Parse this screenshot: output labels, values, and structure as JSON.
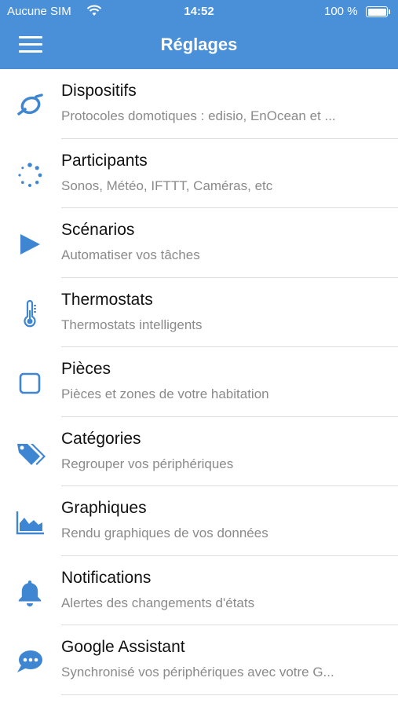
{
  "status_bar": {
    "carrier": "Aucune SIM",
    "time": "14:52",
    "battery_percent": "100 %"
  },
  "header": {
    "title": "Réglages"
  },
  "colors": {
    "accent": "#4a90d9",
    "icon": "#3f86d2"
  },
  "items": [
    {
      "label": "Dispositifs",
      "sub": "Protocoles domotiques : edisio, EnOcean et ...",
      "icon": "loop-icon"
    },
    {
      "label": "Participants",
      "sub": "Sonos, Météo, IFTTT, Caméras, etc",
      "icon": "dots-circle-icon"
    },
    {
      "label": "Scénarios",
      "sub": "Automatiser vos tâches",
      "icon": "play-icon"
    },
    {
      "label": "Thermostats",
      "sub": "Thermostats intelligents",
      "icon": "thermometer-icon"
    },
    {
      "label": "Pièces",
      "sub": "Pièces et zones de votre habitation",
      "icon": "square-icon"
    },
    {
      "label": "Catégories",
      "sub": "Regrouper vos périphériques",
      "icon": "tags-icon"
    },
    {
      "label": "Graphiques",
      "sub": "Rendu graphiques de vos données",
      "icon": "area-chart-icon"
    },
    {
      "label": "Notifications",
      "sub": "Alertes des changements d'états",
      "icon": "bell-icon"
    },
    {
      "label": "Google Assistant",
      "sub": "Synchronisé vos périphériques avec votre G...",
      "icon": "chat-bubble-icon"
    }
  ]
}
